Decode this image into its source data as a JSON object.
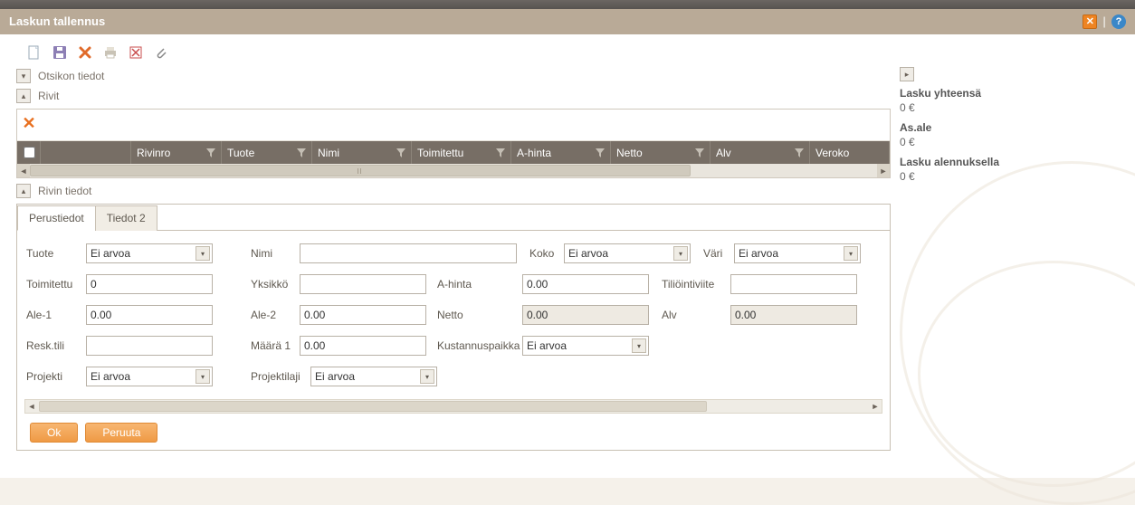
{
  "window": {
    "title": "Laskun tallennus"
  },
  "sections": {
    "header": "Otsikon tiedot",
    "rows": "Rivit",
    "row_details": "Rivin tiedot"
  },
  "grid": {
    "columns": [
      "Rivinro",
      "Tuote",
      "Nimi",
      "Toimitettu",
      "A-hinta",
      "Netto",
      "Alv",
      "Veroko"
    ]
  },
  "tabs": {
    "t1": "Perustiedot",
    "t2": "Tiedot 2"
  },
  "form": {
    "labels": {
      "tuote": "Tuote",
      "nimi": "Nimi",
      "koko": "Koko",
      "vari": "Väri",
      "toimitettu": "Toimitettu",
      "yksikko": "Yksikkö",
      "ahinta": "A-hinta",
      "tiliointiviite": "Tiliöintiviite",
      "ale1": "Ale-1",
      "ale2": "Ale-2",
      "netto": "Netto",
      "alv": "Alv",
      "resktili": "Resk.tili",
      "maara1": "Määrä 1",
      "kustannuspaikka": "Kustannuspaikka",
      "projekti": "Projekti",
      "projektilaji": "Projektilaji"
    },
    "values": {
      "tuote": "Ei arvoa",
      "nimi": "",
      "koko": "Ei arvoa",
      "vari": "Ei arvoa",
      "toimitettu": "0",
      "yksikko": "",
      "ahinta": "0.00",
      "tiliointiviite": "",
      "ale1": "0.00",
      "ale2": "0.00",
      "netto": "0.00",
      "alv": "0.00",
      "resktili": "",
      "maara1": "0.00",
      "kustannuspaikka": "Ei arvoa",
      "projekti": "Ei arvoa",
      "projektilaji": "Ei arvoa"
    }
  },
  "buttons": {
    "ok": "Ok",
    "cancel": "Peruuta"
  },
  "summary": {
    "total_label": "Lasku yhteensä",
    "total_value": "0 €",
    "discount_label": "As.ale",
    "discount_value": "0 €",
    "discounted_label": "Lasku alennuksella",
    "discounted_value": "0 €"
  }
}
